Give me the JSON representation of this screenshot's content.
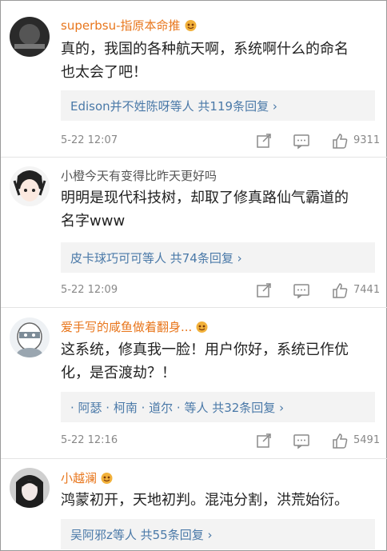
{
  "comments": [
    {
      "username": "superbsu-指原本命推",
      "text_line1": "真的，我国的各种航天啊，系统啊什么的命名",
      "text_line2": "也太会了吧！",
      "replies": "Edison并不姓陈呀等人 共119条回复 ›",
      "time": "5-22 12:07",
      "likes": "9311"
    },
    {
      "username": "小橙今天有变得比昨天更好吗",
      "text_line1": "明明是现代科技树，却取了修真路仙气霸道的",
      "text_line2": "名字www",
      "replies": "皮卡球巧可可等人 共74条回复 ›",
      "time": "5-22 12:09",
      "likes": "7441"
    },
    {
      "username": "爱手写的咸鱼做着翻身...",
      "text_line1": "这系统，修真我一脸！用户你好，系统已作优",
      "text_line2": "化，是否渡劫？！",
      "replies": "· 阿瑟 · 柯南 · 道尔 · 等人 共32条回复 ›",
      "time": "5-22 12:16",
      "likes": "5491"
    },
    {
      "username": "小越澜",
      "text_line1": "鸿蒙初开，天地初判。混沌分割，洪荒始衍。",
      "replies": "吴阿邪z等人 共55条回复 ›"
    }
  ],
  "colors": {
    "accent": "#e8761c",
    "link": "#4a79a8",
    "muted": "#888888"
  },
  "icons": [
    "repost-icon",
    "comment-icon",
    "like-icon",
    "vip-badge-icon"
  ]
}
